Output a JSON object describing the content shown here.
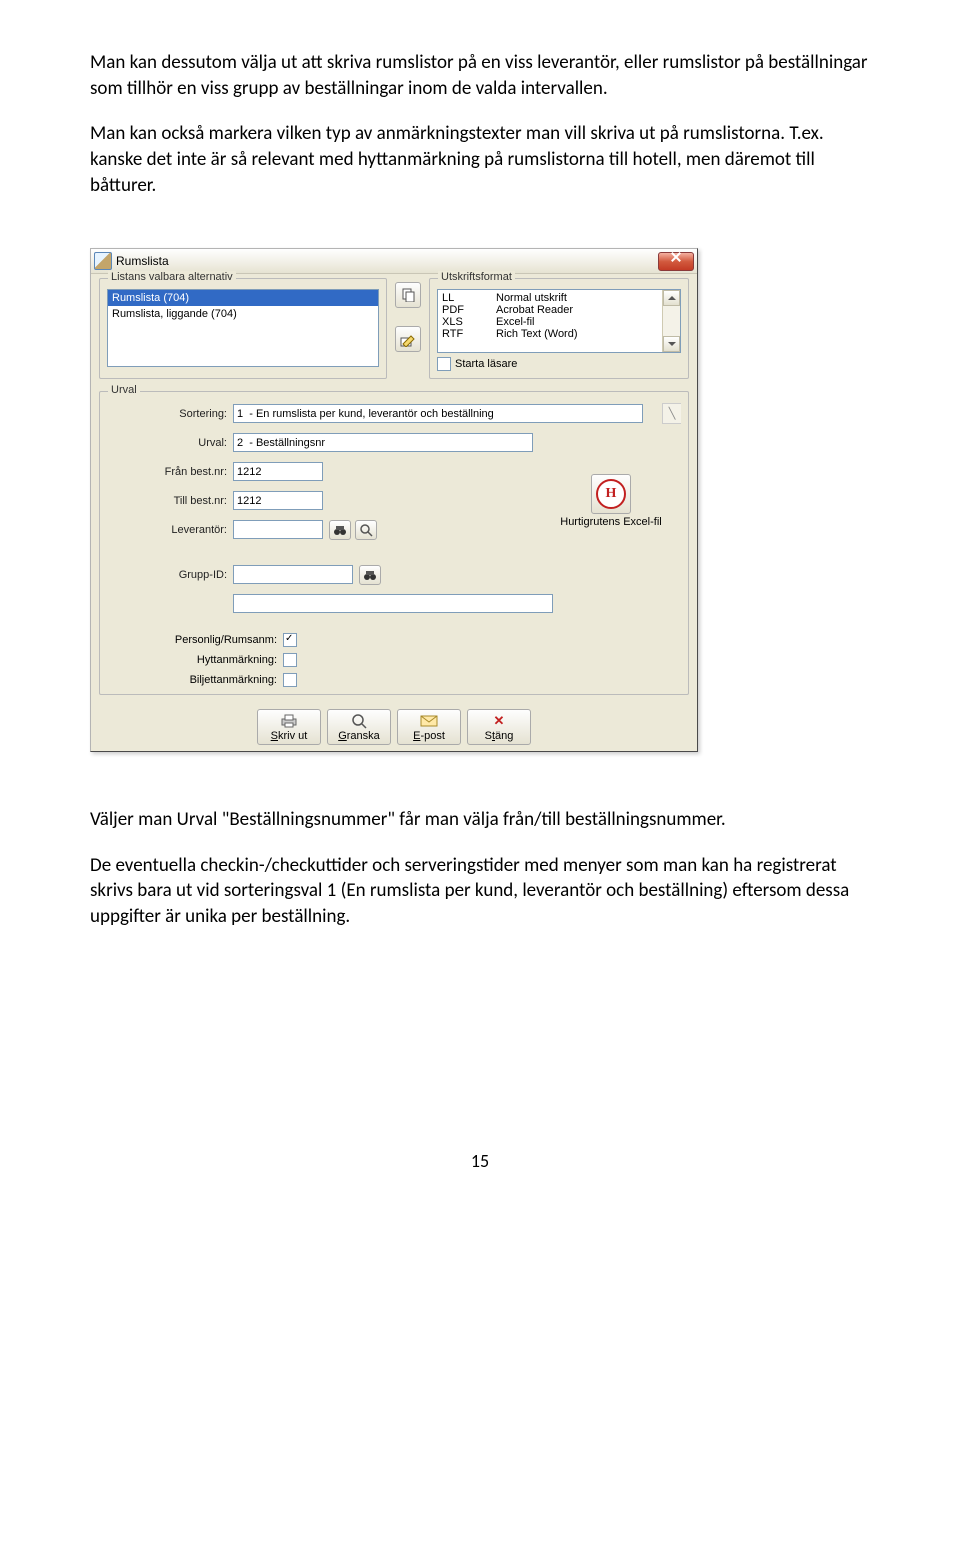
{
  "paragraphs": {
    "p1": "Man kan dessutom välja ut att skriva rumslistor på en viss leverantör, eller rumslistor på beställningar som tillhör en viss grupp av beställningar inom de valda intervallen.",
    "p2": "Man kan också markera vilken typ av anmärkningstexter man vill skriva ut på rumslistorna. T.ex. kanske det inte är så relevant med hyttanmärkning på rumslistorna till hotell, men däremot till båtturer.",
    "p3": "Väljer man Urval \"Beställningsnummer\" får man välja från/till beställningsnummer.",
    "p4": "De eventuella checkin-/checkuttider och serveringstider med menyer som man kan ha registrerat skrivs bara ut vid sorteringsval 1 (En rumslista per kund, leverantör och beställning) eftersom dessa uppgifter är unika per beställning."
  },
  "page_number": "15",
  "dialog": {
    "title": "Rumslista",
    "groups": {
      "lists_legend": "Listans valbara alternativ",
      "fmt_legend": "Utskriftsformat",
      "urval_legend": "Urval"
    },
    "list_options": [
      "Rumslista (704)",
      "Rumslista, liggande (704)"
    ],
    "fmt_options": {
      "codes": [
        "LL",
        "PDF",
        "XLS",
        "RTF"
      ],
      "names": [
        "Normal utskrift",
        "Acrobat Reader",
        "Excel-fil",
        "Rich Text (Word)"
      ]
    },
    "start_reader_label": "Starta läsare",
    "urval": {
      "labels": {
        "sortering": "Sortering:",
        "urval": "Urval:",
        "fran_best": "Från best.nr:",
        "till_best": "Till best.nr:",
        "leverantor": "Leverantör:",
        "grupp_id": "Grupp-ID:",
        "personlig": "Personlig/Rumsanm:",
        "hytt": "Hyttanmärkning:",
        "biljett": "Biljettanmärkning:"
      },
      "values": {
        "sortering": "1  - En rumslista per kund, leverantör och beställning",
        "urval": "2  - Beställningsnr",
        "fran_best": "1212",
        "till_best": "1212",
        "leverantor": "",
        "grupp_id": "",
        "name_field": ""
      }
    },
    "hurtig_label": "Hurtigrutens Excel-fil",
    "buttons": {
      "print": "Skriv ut",
      "preview": "Granska",
      "email": "E-post",
      "close": "Stäng"
    }
  }
}
